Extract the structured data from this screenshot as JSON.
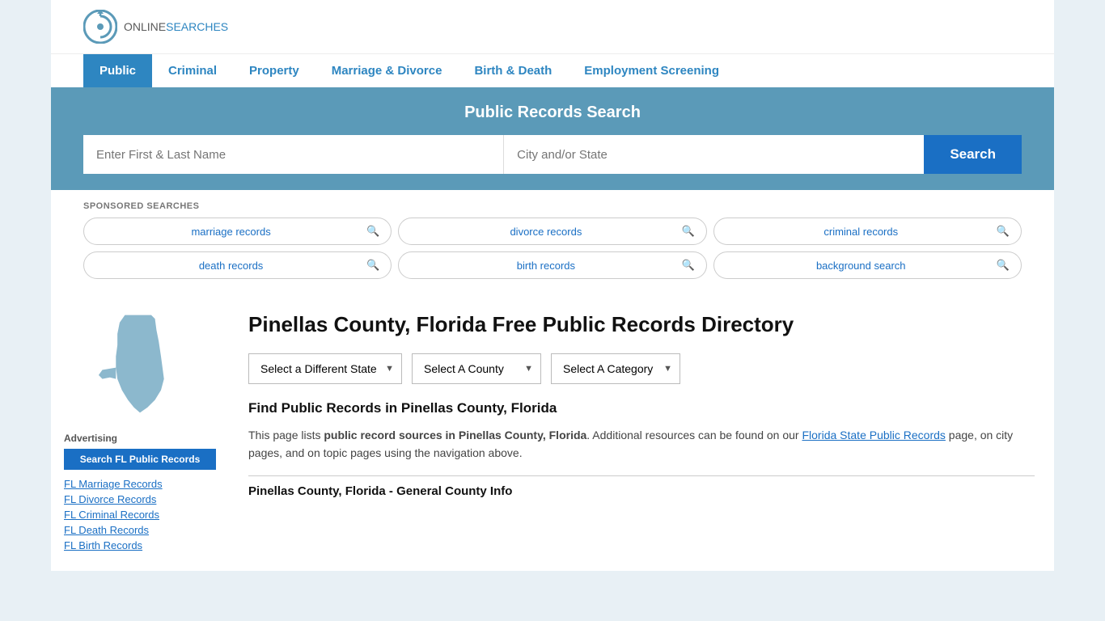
{
  "logo": {
    "online": "ONLINE",
    "searches": "SEARCHES"
  },
  "nav": {
    "items": [
      {
        "label": "Public",
        "active": true
      },
      {
        "label": "Criminal",
        "active": false
      },
      {
        "label": "Property",
        "active": false
      },
      {
        "label": "Marriage & Divorce",
        "active": false
      },
      {
        "label": "Birth & Death",
        "active": false
      },
      {
        "label": "Employment Screening",
        "active": false
      }
    ]
  },
  "search_banner": {
    "title": "Public Records Search",
    "name_placeholder": "Enter First & Last Name",
    "location_placeholder": "City and/or State",
    "button_label": "Search"
  },
  "sponsored": {
    "label": "SPONSORED SEARCHES",
    "items": [
      {
        "text": "marriage records"
      },
      {
        "text": "divorce records"
      },
      {
        "text": "criminal records"
      },
      {
        "text": "death records"
      },
      {
        "text": "birth records"
      },
      {
        "text": "background search"
      }
    ]
  },
  "page": {
    "title": "Pinellas County, Florida Free Public Records Directory",
    "dropdowns": {
      "state": "Select a Different State",
      "county": "Select A County",
      "category": "Select A Category"
    },
    "find_title": "Find Public Records in Pinellas County, Florida",
    "description_part1": "This page lists ",
    "description_bold": "public record sources in Pinellas County, Florida",
    "description_part2": ". Additional resources can be found on our ",
    "description_link": "Florida State Public Records",
    "description_part3": " page, on city pages, and on topic pages using the navigation above.",
    "general_county_title": "Pinellas County, Florida - General County Info"
  },
  "sidebar": {
    "advertising_label": "Advertising",
    "ad_button": "Search FL Public Records",
    "links": [
      "FL Marriage Records",
      "FL Divorce Records",
      "FL Criminal Records",
      "FL Death Records",
      "FL Birth Records"
    ]
  }
}
